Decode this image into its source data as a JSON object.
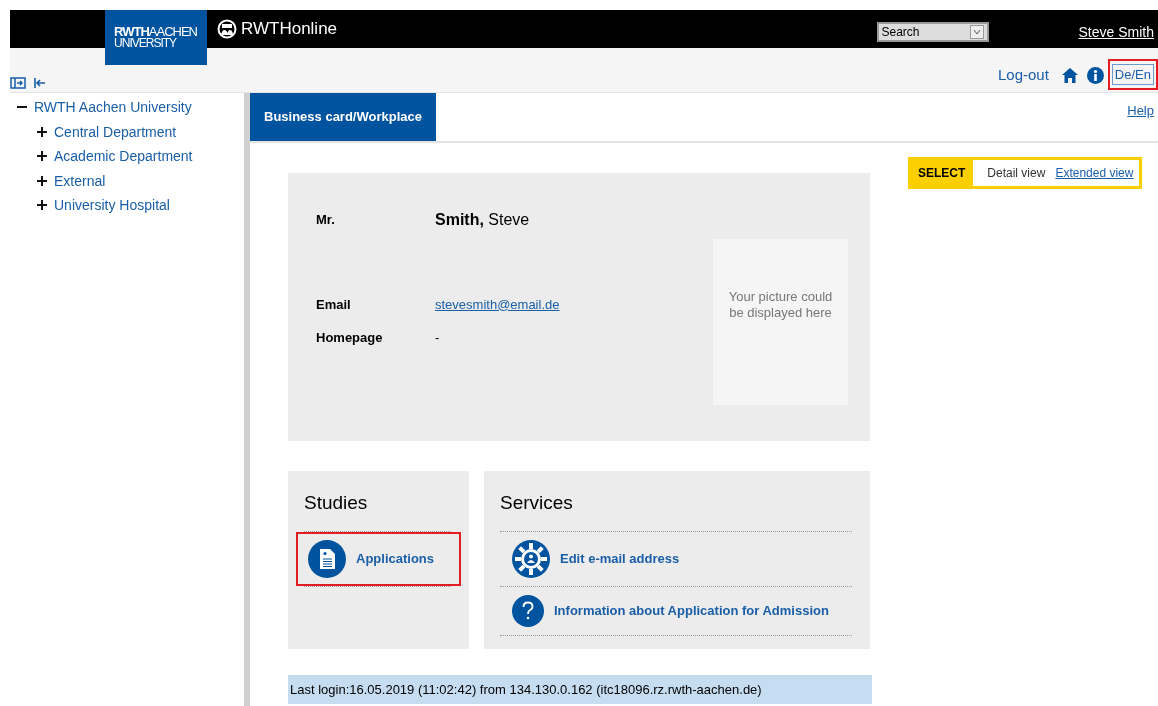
{
  "header": {
    "logo": {
      "word_bold": "RWTH",
      "word_light": "AACHEN",
      "line2": "UNIVERSITY"
    },
    "app_name": "RWTHonline",
    "search": {
      "value": "Search"
    },
    "user": "Steve Smith"
  },
  "toolbar": {
    "logout": "Log-out",
    "language": {
      "label": "De/En",
      "highlighted": true
    }
  },
  "sidebar": {
    "tree": [
      {
        "label": "RWTH Aachen University",
        "expanded": true,
        "children": [
          {
            "label": "Central Department",
            "expanded": false
          },
          {
            "label": "Academic Department",
            "expanded": false
          },
          {
            "label": "External",
            "expanded": false
          },
          {
            "label": "University Hospital",
            "expanded": false
          }
        ]
      }
    ]
  },
  "tabs": [
    {
      "label": "Business card/Workplace",
      "selected": true
    }
  ],
  "help": "Help",
  "view_select": {
    "label": "SELECT",
    "options": [
      {
        "label": "Detail view",
        "selected": true
      },
      {
        "label": "Extended view",
        "selected": false
      }
    ]
  },
  "profile": {
    "salutation": "Mr.",
    "name": "**Smith,** Steve",
    "fields": [
      {
        "label": "Email",
        "value": "stevesmith@email.de",
        "kind": "link"
      },
      {
        "label": "Homepage",
        "value": "-",
        "kind": "text"
      }
    ],
    "photo_placeholder": "Your picture could be displayed here"
  },
  "panels": [
    {
      "title": "Studies",
      "items": [
        {
          "label": "Applications",
          "kind": "document",
          "highlighted": true
        }
      ]
    },
    {
      "title": "Services",
      "items": [
        {
          "label": "Edit e-mail address",
          "kind": "gear",
          "highlighted": false
        },
        {
          "label": "Information about Application for Admission",
          "kind": "question",
          "highlighted": false
        }
      ]
    }
  ],
  "last_login": "Last login:16.05.2019 (11:02:42) from 134.130.0.162 (itc18096.rz.rwth-aachen.de)"
}
